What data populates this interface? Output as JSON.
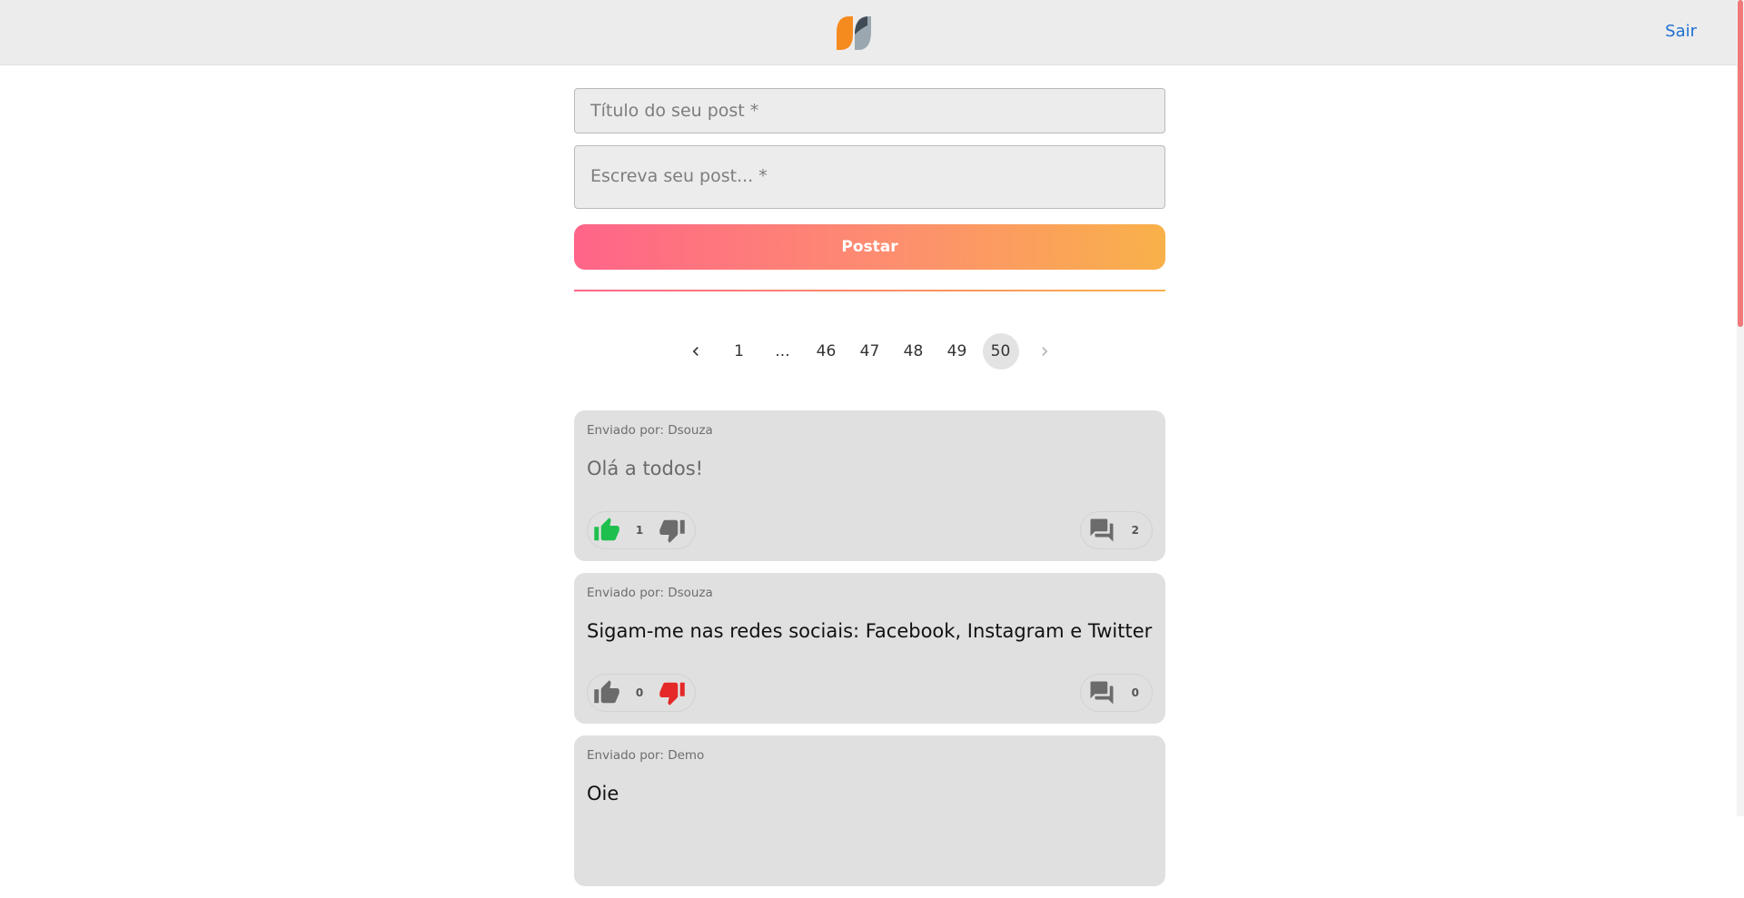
{
  "header": {
    "logout_label": "Sair"
  },
  "form": {
    "title_placeholder": "Título do seu post *",
    "body_placeholder": "Escreva seu post... *",
    "submit_label": "Postar"
  },
  "pagination": {
    "pages": [
      "1",
      "...",
      "46",
      "47",
      "48",
      "49",
      "50"
    ],
    "current": "50"
  },
  "posts": [
    {
      "author": "Enviado por: Dsouza",
      "title": "Olá a todos!",
      "votes": "1",
      "vote_state": "up",
      "comments": "2"
    },
    {
      "author": "Enviado por: Dsouza",
      "title": "Sigam-me nas redes sociais: Facebook, Instagram e Twitter",
      "votes": "0",
      "vote_state": "down",
      "comments": "0"
    },
    {
      "author": "Enviado por: Demo",
      "title": "Oie",
      "votes": "",
      "vote_state": "none",
      "comments": ""
    }
  ],
  "colors": {
    "like_active": "#1fbf4e",
    "dislike_active": "#e52828",
    "icon_neutral": "#6b6b6b",
    "link": "#1f6fd1",
    "gradient_start": "#ff6489",
    "gradient_end": "#f9b14a"
  },
  "icons": [
    "logo",
    "chevron-left-icon",
    "chevron-right-icon",
    "thumb-up-icon",
    "thumb-down-icon",
    "comments-icon"
  ]
}
